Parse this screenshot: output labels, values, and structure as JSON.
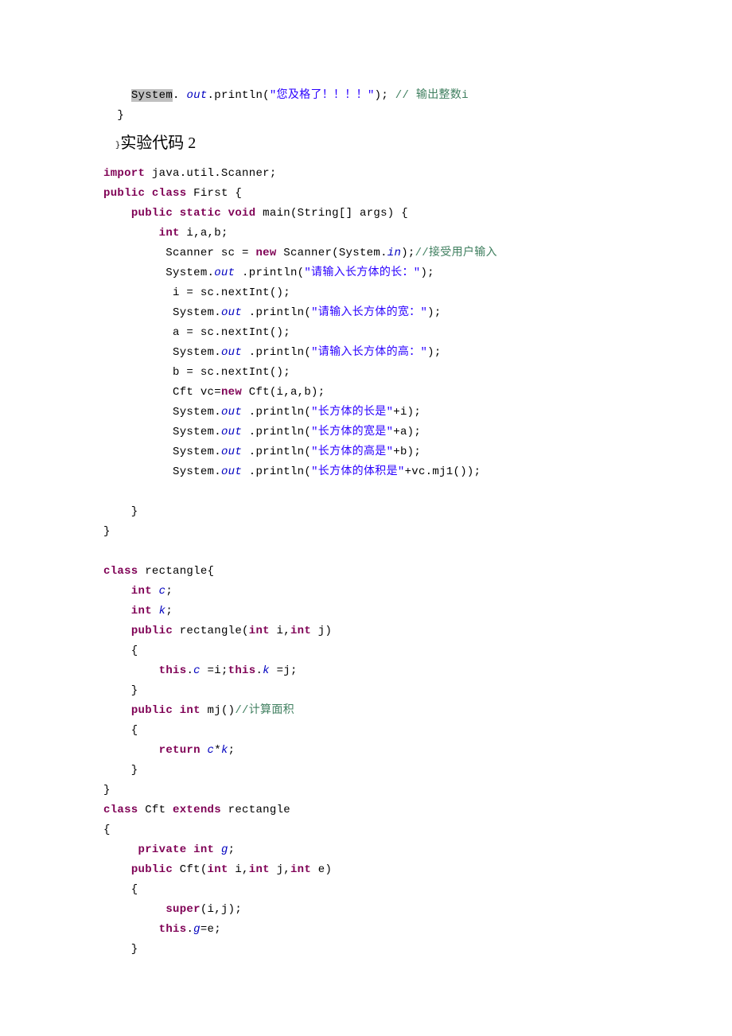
{
  "snippet1": {
    "line1_prefix": "    ",
    "line1_sys": "System",
    "line1_dot": ". ",
    "line1_out": "out",
    "line1_println": ".println(",
    "line1_str": "\"您及格了！！！！\"",
    "line1_end": "); ",
    "line1_cmt_slash": "// ",
    "line1_cmt": "输出整数i",
    "line2": "  }"
  },
  "heading": {
    "brace": "}",
    "title": "实验代码 2"
  },
  "code2": {
    "l1_import": "import",
    "l1_rest": " java.util.Scanner;",
    "l2_public": "public",
    "l2_class": " class",
    "l2_rest": " First {",
    "l3_prefix": "    ",
    "l3_public": "public",
    "l3_static": " static",
    "l3_void": " void",
    "l3_rest": " main(String[] args) {",
    "l4_prefix": "        ",
    "l4_int": "int",
    "l4_rest": " i,a,b;",
    "l5_a": "         Scanner sc = ",
    "l5_new": "new",
    "l5_b": " Scanner(System.",
    "l5_in": "in",
    "l5_c": ");",
    "l5_cmt": "//接受用户输入",
    "l6_a": "         System.",
    "l6_out": "out",
    "l6_b": " .println(",
    "l6_str": "\"请输入长方体的长：\"",
    "l6_c": ");",
    "l7": "          i = sc.nextInt();",
    "l8_a": "          System.",
    "l8_out": "out",
    "l8_b": " .println(",
    "l8_str": "\"请输入长方体的宽：\"",
    "l8_c": ");",
    "l9": "          a = sc.nextInt();",
    "l10_a": "          System.",
    "l10_out": "out",
    "l10_b": " .println(",
    "l10_str": "\"请输入长方体的高：\"",
    "l10_c": ");",
    "l11": "          b = sc.nextInt();",
    "l12_a": "          Cft vc=",
    "l12_new": "new",
    "l12_b": " Cft(i,a,b);",
    "l13_a": "          System.",
    "l13_out": "out",
    "l13_b": " .println(",
    "l13_str": "\"长方体的长是\"",
    "l13_c": "+i);",
    "l14_a": "          System.",
    "l14_out": "out",
    "l14_b": " .println(",
    "l14_str": "\"长方体的宽是\"",
    "l14_c": "+a);",
    "l15_a": "          System.",
    "l15_out": "out",
    "l15_b": " .println(",
    "l15_str": "\"长方体的高是\"",
    "l15_c": "+b);",
    "l16_a": "          System.",
    "l16_out": "out",
    "l16_b": " .println(",
    "l16_str": "\"长方体的体积是\"",
    "l16_c": "+vc.mj1());",
    "l17": "",
    "l18": "    }",
    "l19": "}",
    "l20": "",
    "l21_class": "class",
    "l21_rest": " rectangle{",
    "l22_int": "    int",
    "l22_c": " c",
    "l22_semi": ";",
    "l23_int": "    int",
    "l23_k": " k",
    "l23_semi": ";",
    "l24_pre": "    ",
    "l24_public": "public",
    "l24_a": " rectangle(",
    "l24_int1": "int",
    "l24_b": " i,",
    "l24_int2": "int",
    "l24_c": " j)",
    "l25": "    {",
    "l26_pre": "        ",
    "l26_this1": "this",
    "l26_a": ".",
    "l26_c": "c",
    "l26_eq1": " =i;",
    "l26_this2": "this",
    "l26_b": ".",
    "l26_k": "k",
    "l26_eq2": " =j;",
    "l27": "    }",
    "l28_pre": "    ",
    "l28_public": "public",
    "l28_int": " int",
    "l28_a": " mj()",
    "l28_cmt": "//计算面积",
    "l29": "    {",
    "l30_pre": "        ",
    "l30_return": "return",
    "l30_sp": " ",
    "l30_c": "c",
    "l30_star": "*",
    "l30_k": "k",
    "l30_semi": ";",
    "l31": "    }",
    "l32": "}",
    "l33_class": "class",
    "l33_a": " Cft ",
    "l33_extends": "extends",
    "l33_b": " rectangle",
    "l34": "{",
    "l35_pre": "     ",
    "l35_private": "private",
    "l35_int": " int",
    "l35_sp": " ",
    "l35_g": "g",
    "l35_semi": ";",
    "l36_pre": "    ",
    "l36_public": "public",
    "l36_a": " Cft(",
    "l36_int1": "int",
    "l36_b": " i,",
    "l36_int2": "int",
    "l36_c": " j,",
    "l36_int3": "int",
    "l36_d": " e)",
    "l37": "    {",
    "l38_pre": "         ",
    "l38_super": "super",
    "l38_a": "(i,j);",
    "l39_pre": "        ",
    "l39_this": "this",
    "l39_a": ".",
    "l39_g": "g",
    "l39_b": "=e;",
    "l40": "    }"
  }
}
